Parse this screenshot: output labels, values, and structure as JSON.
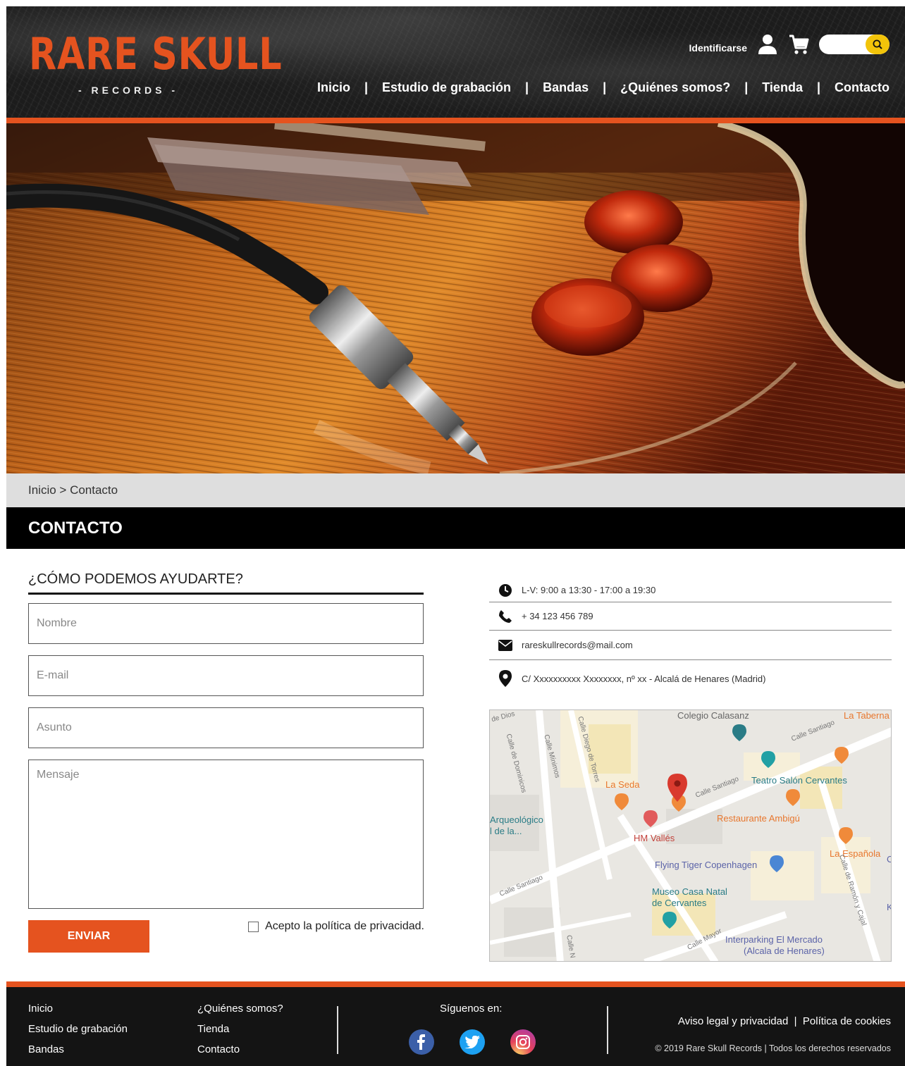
{
  "brand": {
    "name": "RARE SKULL",
    "sub": "- RECORDS -",
    "accent": "#e5531f"
  },
  "topbar": {
    "login_label": "Identificarse",
    "search_placeholder": ""
  },
  "nav": {
    "items": [
      "Inicio",
      "Estudio de grabación",
      "Bandas",
      "¿Quiénes somos?",
      "Tienda",
      "Contacto"
    ],
    "separator": "|"
  },
  "breadcrumb": {
    "home": "Inicio",
    "separator": " > ",
    "current": "Contacto"
  },
  "page_title": "CONTACTO",
  "form": {
    "title": "¿CÓMO PODEMOS AYUDARTE?",
    "name_placeholder": "Nombre",
    "email_placeholder": "E-mail",
    "subject_placeholder": "Asunto",
    "message_placeholder": "Mensaje",
    "submit_label": "ENVIAR",
    "privacy_label": "Acepto la política de privacidad."
  },
  "contact": {
    "hours": "L-V: 9:00 a 13:30 - 17:00 a 19:30",
    "phone": "+ 34 123 456 789",
    "email": "rareskullrecords@mail.com",
    "address": "C/ Xxxxxxxxxx Xxxxxxxx, nº xx - Alcalá de Henares (Madrid)"
  },
  "map": {
    "labels": {
      "colegio": "Colegio Calasanz",
      "taberna": "La Taberna",
      "teatro": "Teatro Salón Cervantes",
      "la_seda": "La Seda",
      "restaurante": "Restaurante Ambigú",
      "arqueologico1": "Arqueológico",
      "arqueologico2": "l de la...",
      "hm_valles": "HM Vallés",
      "la_espanola": "La Española",
      "flying_tiger": "Flying Tiger Copenhagen",
      "museo1": "Museo Casa Natal",
      "museo2": "de Cervantes",
      "interparking1": "Interparking El Mercado",
      "interparking2": "(Alcala de Henares)",
      "k": "K",
      "c": "C"
    },
    "streets": {
      "de_dios": "de Dios",
      "dominicos": "Calle de Dominicos",
      "minimos": "Calle Mínimos",
      "diego_torres": "Calle Diego de Torres",
      "santiago1": "Calle Santiago",
      "santiago2": "Calle Santiago",
      "santiago3": "Calle Santiago",
      "mayor": "Calle Mayor",
      "ramon_cajal": "Calle de Ramón y Cajal",
      "calle_n": "Calle N"
    }
  },
  "footer": {
    "col1": [
      "Inicio",
      "Estudio de grabación",
      "Bandas"
    ],
    "col2": [
      "¿Quiénes somos?",
      "Tienda",
      "Contacto"
    ],
    "follow_label": "Síguenos en:",
    "legal_link": "Aviso legal y privacidad",
    "legal_sep": "|",
    "cookies_link": "Política de cookies",
    "copyright": "© 2019 Rare Skull Records | Todos los derechos reservados"
  }
}
